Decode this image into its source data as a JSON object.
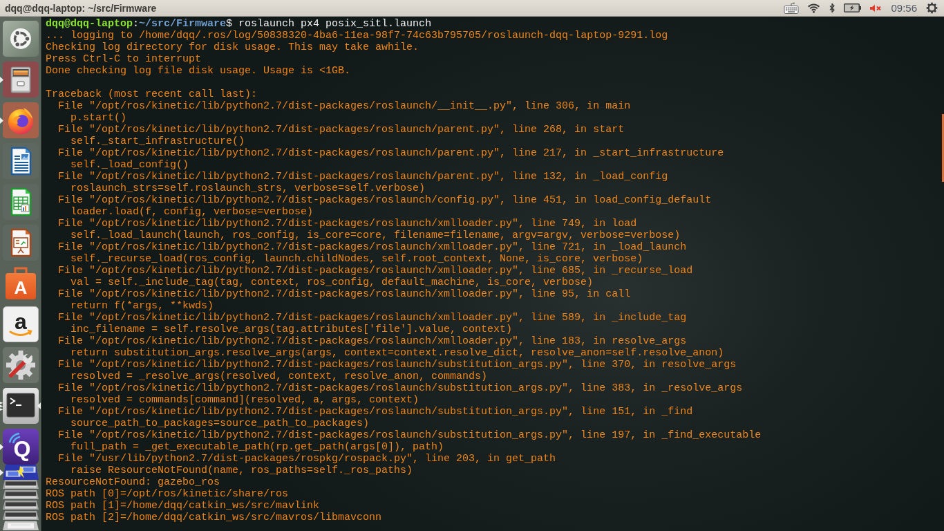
{
  "top_panel": {
    "title": "dqq@dqq-laptop: ~/src/Firmware",
    "indicators": [
      {
        "kind": "keyboard"
      },
      {
        "kind": "wifi"
      },
      {
        "kind": "bluetooth"
      },
      {
        "kind": "battery"
      },
      {
        "kind": "sound_muted"
      },
      {
        "kind": "clock",
        "text": "09:56"
      },
      {
        "kind": "session"
      }
    ]
  },
  "launcher": {
    "items": [
      {
        "kind": "dash",
        "running": false,
        "multiple_windows": false,
        "focused": false,
        "collapsed": false
      },
      {
        "kind": "files",
        "running": true,
        "multiple_windows": false,
        "focused": false,
        "collapsed": false
      },
      {
        "kind": "browser",
        "running": true,
        "multiple_windows": false,
        "focused": false,
        "collapsed": false
      },
      {
        "kind": "writer",
        "running": false,
        "multiple_windows": false,
        "focused": false,
        "collapsed": false
      },
      {
        "kind": "calc",
        "running": false,
        "multiple_windows": false,
        "focused": false,
        "collapsed": false
      },
      {
        "kind": "impress",
        "running": false,
        "multiple_windows": false,
        "focused": false,
        "collapsed": false
      },
      {
        "kind": "software",
        "glyph": "A",
        "running": false,
        "multiple_windows": false,
        "focused": false,
        "collapsed": false
      },
      {
        "kind": "shop",
        "glyph": "a",
        "running": false,
        "multiple_windows": false,
        "focused": false,
        "collapsed": false
      },
      {
        "kind": "settings",
        "running": false,
        "multiple_windows": false,
        "focused": false,
        "collapsed": false
      },
      {
        "kind": "terminal",
        "running": true,
        "multiple_windows": true,
        "focused": true,
        "collapsed": false
      },
      {
        "kind": "qlogo",
        "glyph": "Q",
        "running": true,
        "multiple_windows": false,
        "focused": false,
        "collapsed": false
      },
      {
        "kind": "network",
        "running": true,
        "multiple_windows": false,
        "focused": false,
        "collapsed": true
      },
      {
        "kind": "app",
        "running": false,
        "multiple_windows": false,
        "focused": false,
        "collapsed": true
      },
      {
        "kind": "app",
        "running": false,
        "multiple_windows": false,
        "focused": false,
        "collapsed": true
      },
      {
        "kind": "app",
        "running": false,
        "multiple_windows": false,
        "focused": false,
        "collapsed": true
      },
      {
        "kind": "app",
        "running": false,
        "multiple_windows": false,
        "focused": false,
        "collapsed": true
      },
      {
        "kind": "trash",
        "running": false,
        "multiple_windows": false,
        "focused": false,
        "collapsed": true
      }
    ]
  },
  "terminal": {
    "prompt": {
      "user_host": "dqq@dqq-laptop",
      "separator": ":",
      "path": "~/src/Firmware",
      "symbol": "$",
      "command": "roslaunch px4 posix_sitl.launch"
    },
    "blocks": [
      {
        "lines": [
          {
            "text": "... logging to /home/dqq/.ros/log/50838320-4ba6-11ea-98f7-74c63b795705/roslaunch-dqq-laptop-9291.log"
          },
          {
            "text": "Checking log directory for disk usage. This may take awhile."
          },
          {
            "text": "Press Ctrl-C to interrupt"
          },
          {
            "text": "Done checking log file disk usage. Usage is <1GB."
          }
        ]
      },
      {
        "lines": [
          {
            "text": "Traceback (most recent call last):",
            "children": [
              {
                "text": "File \"/opt/ros/kinetic/lib/python2.7/dist-packages/roslaunch/__init__.py\", line 306, in main",
                "children": [
                  {
                    "text": "p.start()"
                  }
                ]
              },
              {
                "text": "File \"/opt/ros/kinetic/lib/python2.7/dist-packages/roslaunch/parent.py\", line 268, in start",
                "children": [
                  {
                    "text": "self._start_infrastructure()"
                  }
                ]
              },
              {
                "text": "File \"/opt/ros/kinetic/lib/python2.7/dist-packages/roslaunch/parent.py\", line 217, in _start_infrastructure",
                "children": [
                  {
                    "text": "self._load_config()"
                  }
                ]
              },
              {
                "text": "File \"/opt/ros/kinetic/lib/python2.7/dist-packages/roslaunch/parent.py\", line 132, in _load_config",
                "children": [
                  {
                    "text": "roslaunch_strs=self.roslaunch_strs, verbose=self.verbose)"
                  }
                ]
              },
              {
                "text": "File \"/opt/ros/kinetic/lib/python2.7/dist-packages/roslaunch/config.py\", line 451, in load_config_default",
                "children": [
                  {
                    "text": "loader.load(f, config, verbose=verbose)"
                  }
                ]
              },
              {
                "text": "File \"/opt/ros/kinetic/lib/python2.7/dist-packages/roslaunch/xmlloader.py\", line 749, in load",
                "children": [
                  {
                    "text": "self._load_launch(launch, ros_config, is_core=core, filename=filename, argv=argv, verbose=verbose)"
                  }
                ]
              },
              {
                "text": "File \"/opt/ros/kinetic/lib/python2.7/dist-packages/roslaunch/xmlloader.py\", line 721, in _load_launch",
                "children": [
                  {
                    "text": "self._recurse_load(ros_config, launch.childNodes, self.root_context, None, is_core, verbose)"
                  }
                ]
              },
              {
                "text": "File \"/opt/ros/kinetic/lib/python2.7/dist-packages/roslaunch/xmlloader.py\", line 685, in _recurse_load",
                "children": [
                  {
                    "text": "val = self._include_tag(tag, context, ros_config, default_machine, is_core, verbose)"
                  }
                ]
              },
              {
                "text": "File \"/opt/ros/kinetic/lib/python2.7/dist-packages/roslaunch/xmlloader.py\", line 95, in call",
                "children": [
                  {
                    "text": "return f(*args, **kwds)"
                  }
                ]
              },
              {
                "text": "File \"/opt/ros/kinetic/lib/python2.7/dist-packages/roslaunch/xmlloader.py\", line 589, in _include_tag",
                "children": [
                  {
                    "text": "inc_filename = self.resolve_args(tag.attributes['file'].value, context)"
                  }
                ]
              },
              {
                "text": "File \"/opt/ros/kinetic/lib/python2.7/dist-packages/roslaunch/xmlloader.py\", line 183, in resolve_args",
                "children": [
                  {
                    "text": "return substitution_args.resolve_args(args, context=context.resolve_dict, resolve_anon=self.resolve_anon)"
                  }
                ]
              },
              {
                "text": "File \"/opt/ros/kinetic/lib/python2.7/dist-packages/roslaunch/substitution_args.py\", line 370, in resolve_args",
                "children": [
                  {
                    "text": "resolved = _resolve_args(resolved, context, resolve_anon, commands)"
                  }
                ]
              },
              {
                "text": "File \"/opt/ros/kinetic/lib/python2.7/dist-packages/roslaunch/substitution_args.py\", line 383, in _resolve_args",
                "children": [
                  {
                    "text": "resolved = commands[command](resolved, a, args, context)"
                  }
                ]
              },
              {
                "text": "File \"/opt/ros/kinetic/lib/python2.7/dist-packages/roslaunch/substitution_args.py\", line 151, in _find",
                "children": [
                  {
                    "text": "source_path_to_packages=source_path_to_packages)"
                  }
                ]
              },
              {
                "text": "File \"/opt/ros/kinetic/lib/python2.7/dist-packages/roslaunch/substitution_args.py\", line 197, in _find_executable",
                "children": [
                  {
                    "text": "full_path = _get_executable_path(rp.get_path(args[0]), path)"
                  }
                ]
              },
              {
                "text": "File \"/usr/lib/python2.7/dist-packages/rospkg/rospack.py\", line 203, in get_path",
                "children": [
                  {
                    "text": "raise ResourceNotFound(name, ros_paths=self._ros_paths)"
                  }
                ]
              }
            ]
          },
          {
            "text": "ResourceNotFound: gazebo_ros"
          },
          {
            "text": "ROS path [0]=/opt/ros/kinetic/share/ros"
          },
          {
            "text": "ROS path [1]=/home/dqq/catkin_ws/src/mavlink"
          },
          {
            "text": "ROS path [2]=/home/dqq/catkin_ws/src/mavros/libmavconn"
          }
        ]
      }
    ]
  }
}
